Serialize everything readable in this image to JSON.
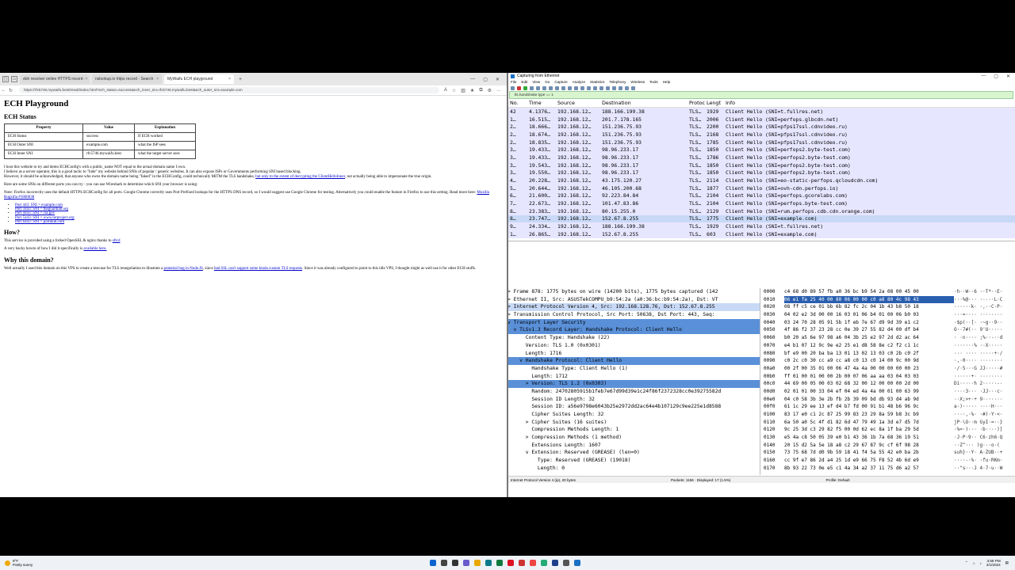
{
  "browser": {
    "tabs": [
      {
        "label": "doh resolver online HTTPS record ·"
      },
      {
        "label": "nslookup.io https record - Search"
      },
      {
        "label": "MyWaifu ECH playground"
      }
    ],
    "url": "https://rfc5746.mywaifu.best/result/index.html?ech_status=success&ech_inner_sni=rfc5746.mywaifu.best&ech_outer_sni=example.com",
    "page": {
      "title": "ECH Playground",
      "status_heading": "ECH Status",
      "table_headers": [
        "Property",
        "Value",
        "Explanation"
      ],
      "table_rows": [
        [
          "ECH Status",
          "success",
          "If ECH worked"
        ],
        [
          "ECH Outer SNI",
          "example.com",
          "what the ISP sees"
        ],
        [
          "ECH Inner SNI",
          "rfc5746.mywaifu.best",
          "what the target server sees"
        ]
      ],
      "para1": "I host this website to try and demo ECHConfig's with a public_name NOT equal to the actual domain name I own.",
      "para2": "I believe as a server operator, this is a good tactic to \"hide\" my website behind SNIs of popular / generic websites. It can also expose ISPs or Governments performing SNI based blocking.",
      "para3a": "However, it should be acknowledged, that anyone who owns the domain name being \"faked\" in the ECHConfig, could technically MiTM the TLS handshake,",
      "para3link": "but only to the extent of decrypting the ClientHelloInner",
      "para3b": ", not actually being able to impersonate the true origin.",
      "para4": "Here are some SNIs on different ports you can try - you can use Wireshark to determine which SNI your browser is using:",
      "para5a": "Note: Firefox incorrectly uses the default HTTPS ECHConfig for all ports. Google Chrome correctly uses Port Prefixed lookups for the HTTPS DNS record, so I would suggest use Google Chrome for testing. Alternatively you could enable the feature in Firefox to use this setting. Read more here:",
      "para5link": "Mozilla Bugzilla #1860038",
      "ports": [
        "Port 443: SNI = example.com",
        "Port 3443: SNI = theguardian.org",
        "Port 4443: SNI = cia.gov",
        "Port 5443: SNI = www.torproject.org",
        "Port 6443: SNI = pornhub.com"
      ],
      "how_heading": "How?",
      "how1a": "This service is provided using a forked OpenSSL & nginx thanks to",
      "how1link": "sftcd",
      "how2a": "A very hacky howto of how I did it specifically is",
      "how2link": "available here.",
      "why_heading": "Why this domain?",
      "why_a": "Well actually I used this domain on this VPS to create a testcase for TLS renegotiation to illustrate a",
      "why_link1": "potential bug in Node.JS",
      "why_b": ", since",
      "why_link2": "bad SSL can't support some kinda custom TLS requests",
      "why_c": ". Since it was already configured to point to this idle VPS, I thought might as well use it for other ECH stuffs."
    }
  },
  "wireshark": {
    "title": "Capturing from Ethernet",
    "menu": [
      "File",
      "Edit",
      "View",
      "Go",
      "Capture",
      "Analyze",
      "Statistics",
      "Telephony",
      "Wireless",
      "Tools",
      "Help"
    ],
    "filter": "tls.handshake.type == 1",
    "columns": [
      "No.",
      "Time",
      "Source",
      "Destination",
      "Protocol",
      "Length",
      "Info"
    ],
    "columns_display": [
      "No.",
      "Time",
      "Source",
      "Destination",
      "Protoc",
      "Lengt",
      "Info"
    ],
    "packets": [
      [
        "42",
        "4.1376…",
        "192.168.12…",
        "188.166.199.38",
        "TLS…",
        "1929",
        "Client Hello (SNI=t.fullres.net)"
      ],
      [
        "1…",
        "16.515…",
        "192.168.12…",
        "201.7.178.165",
        "TLS…",
        "2006",
        "Client Hello (SNI=perfops.glbcdn.net)"
      ],
      [
        "2…",
        "18.666…",
        "192.168.12…",
        "151.236.75.93",
        "TLS…",
        "2200",
        "Client Hello (SNI=pfps17ssl.cdnvideo.ru)"
      ],
      [
        "2…",
        "18.674…",
        "192.168.12…",
        "151.236.75.93",
        "TLS…",
        "2168",
        "Client Hello (SNI=pfps17ssl.cdnvideo.ru)"
      ],
      [
        "2…",
        "18.835…",
        "192.168.12…",
        "151.236.75.93",
        "TLS…",
        "1785",
        "Client Hello (SNI=pfps17ssl.cdnvideo.ru)"
      ],
      [
        "3…",
        "19.433…",
        "192.168.12…",
        "98.96.233.17",
        "TLS…",
        "1850",
        "Client Hello (SNI=perfops2.byte-test.com)"
      ],
      [
        "3…",
        "19.433…",
        "192.168.12…",
        "98.96.233.17",
        "TLS…",
        "1786",
        "Client Hello (SNI=perfops2.byte-test.com)"
      ],
      [
        "3…",
        "19.543…",
        "192.168.12…",
        "98.96.233.17",
        "TLS…",
        "1850",
        "Client Hello (SNI=perfops2.byte-test.com)"
      ],
      [
        "3…",
        "19.550…",
        "192.168.12…",
        "98.96.233.17",
        "TLS…",
        "1850",
        "Client Hello (SNI=perfops2.byte-test.com)"
      ],
      [
        "4…",
        "20.228…",
        "192.168.12…",
        "43.175.120.27",
        "TLS…",
        "2114",
        "Client Hello (SNI=eo-static-perfops.qcloudcdn.com)"
      ],
      [
        "5…",
        "20.644…",
        "192.168.12…",
        "46.105.200.68",
        "TLS…",
        "1877",
        "Client Hello (SNI=ovh-cdn.perfops.io)"
      ],
      [
        "6…",
        "21.600…",
        "192.168.12…",
        "92.223.84.84",
        "TLS…",
        "2104",
        "Client Hello (SNI=perfops.gcorelabs.com)"
      ],
      [
        "7…",
        "22.673…",
        "192.168.12…",
        "101.47.83.86",
        "TLS…",
        "2104",
        "Client Hello (SNI=perfops.byte-test.com)"
      ],
      [
        "8…",
        "23.383…",
        "192.168.12…",
        "80.15.255.0",
        "TLS…",
        "2129",
        "Client Hello (SNI=rum.perfops.cdb.cdn.orange.com)"
      ],
      [
        "8…",
        "23.747…",
        "192.168.12…",
        "152.67.8.255",
        "TLS…",
        "1775",
        "Client Hello (SNI=example.com)"
      ],
      [
        "9…",
        "24.334…",
        "192.168.12…",
        "188.166.199.38",
        "TLS…",
        "1929",
        "Client Hello (SNI=t.fullres.net)"
      ],
      [
        "1…",
        "26.865…",
        "192.168.12…",
        "152.67.8.255",
        "TLS…",
        "603",
        "Client Hello (SNI=example.com)"
      ]
    ],
    "details": [
      "> Frame 878: 1775 bytes on wire (14200 bits), 1775 bytes captured (142",
      "> Ethernet II, Src: ASUSTekCOMPU_b9:54:2a (a0:36:bc:b9:54:2a), Dst: VT",
      "> Internet Protocol Version 4, Src: 192.168.128.76, Dst: 152.67.8.255",
      "> Transmission Control Protocol, Src Port: 50638, Dst Port: 443, Seq:",
      "v Transport Layer Security",
      "  v TLSv1.3 Record Layer: Handshake Protocol: Client Hello",
      "      Content Type: Handshake (22)",
      "      Version: TLS 1.0 (0x0301)",
      "      Length: 1716",
      "    v Handshake Protocol: Client Hello",
      "        Handshake Type: Client Hello (1)",
      "        Length: 1712",
      "      > Version: TLS 1.2 (0x0303)",
      "        Random: 24702805915b1feb7e67d99d39e1c24f86f2372328cc0e39275582d",
      "        Session ID Length: 32",
      "        Session ID: a56e9798e6043b25e2972dd2ac64e4b107129c9ee225e1d8588",
      "        Cipher Suites Length: 32",
      "      > Cipher Suites (16 suites)",
      "        Compression Methods Length: 1",
      "      > Compression Methods (1 method)",
      "        Extensions Length: 1607",
      "      v Extension: Reserved (GREASE) (len=0)",
      "          Type: Reserved (GREASE) (19018)",
      "          Length: 0"
    ],
    "hex": [
      [
        "0000",
        "c4 68 d0 89 57 fb a0 36 bc b9 54 2a 08 00 45 00",
        "·h··W··6 ··T*··E·"
      ],
      [
        "0010",
        "06 e1 fa 25 40 00 80 06 00 00 c0 a8 80 4c 98 43",
        "···%@··· ·····L·C"
      ],
      [
        "0020",
        "08 ff c5 ce 01 bb 6b 82 fc 2c 04 1b 43 b8 50 18",
        "······k· ·,··C·P·"
      ],
      [
        "0030",
        "04 02 e2 3d 00 00 16 03 01 06 b4 01 00 06 b0 03",
        "···=···· ········"
      ],
      [
        "0040",
        "03 24 70 28 05 91 5b 1f eb 7e 67 d9 9d 39 e1 c2",
        "·$p(··[· ·~g··9··"
      ],
      [
        "0050",
        "4f 86 f2 37 23 28 cc 0e 39 27 55 82 d4 00 df b4",
        "O··7#(·· 9'U·····"
      ],
      [
        "0060",
        "b0 20 a5 6e 97 98 a6 04 3b 25 e2 97 2d d2 ac 64",
        "· ·n···· ;%··-··d"
      ],
      [
        "0070",
        "e4 b1 07 12 9c 9e e2 25 e1 d8 58 8e c2 f2 c1 1c",
        "·······% ··X·····"
      ],
      [
        "0080",
        "bf e9 00 20 ba ba 13 01 13 02 13 03 c0 2b c0 2f",
        "··· ···· ·····+·/"
      ],
      [
        "0090",
        "c0 2c c0 30 cc a9 cc a8 c0 13 c0 14 00 9c 00 9d",
        "·,·0···· ········"
      ],
      [
        "00a0",
        "00 2f 00 35 01 00 06 47 4a 4a 00 00 00 00 00 23",
        "·/·5···G JJ·····#"
      ],
      [
        "00b0",
        "ff 01 00 01 00 00 2b 00 07 06 aa aa 03 04 03 03",
        "······+· ········"
      ],
      [
        "00c0",
        "44 69 00 05 00 03 02 68 32 00 12 00 00 00 2d 00",
        "Di·····h 2·····-·"
      ],
      [
        "00d0",
        "02 01 01 00 33 04 ef 04 ed 4a 4a 00 01 00 63 99",
        "····3··· ·JJ···c·"
      ],
      [
        "00e0",
        "04 c0 58 3b 3e 2b fb 2b 39 09 bd db 93 d4 ab 9d",
        "··X;>+·+ 9·······"
      ],
      [
        "00f0",
        "61 1c 29 ee 13 ef d4 b7 fd 00 91 b1 48 b6 96 9c",
        "a·)····· ····H···"
      ],
      [
        "0100",
        "83 17 e0 c1 2c 87 25 99 83 23 29 8a 59 b8 3c b9",
        "····,·%· ·#)·Y·<·"
      ],
      [
        "0110",
        "6a 50 a0 5c 4f d1 82 6d 47 79 49 1a 3d e7 d5 7d",
        "jP·\\O··m GyI·=··}"
      ],
      [
        "0120",
        "9c 25 3d c3 29 82 f5 00 0d 62 ec 8a 1f ba 29 5d",
        "·%=·)··· ·b····)]"
      ],
      [
        "0130",
        "e5 4a c8 50 05 39 e0 b1 43 36 1b 7a 68 36 19 51",
        "·J·P·9·· C6·zh6·Q"
      ],
      [
        "0140",
        "20 15 d2 5a 5e 18 a8 c2 29 67 87 9c cf 6f 98 28",
        " ··Z^··· )g···o·("
      ],
      [
        "0150",
        "73 75 68 7d d0 9b 59 18 41 f4 5a 55 42 e0 ba 2b",
        "suh}··Y· A·ZUB··+"
      ],
      [
        "0160",
        "cc 9f e7 86 2d a4 25 1d e9 66 75 F8 52 4b 6d e9",
        "····-·%· ·fu·RKm·"
      ],
      [
        "0170",
        "8b 93 22 73 0e e5 c1 4a 34 a2 37 11 75 d6 a2 57",
        "··\"s···J 4·7·u··W"
      ]
    ],
    "status_left": "Internet Protocol Version 4 (ip), 20 bytes",
    "status_mid": "Packets: 1156 · Displayed: 17 (1.5%)",
    "status_right": "Profile: Default"
  },
  "taskbar": {
    "temp": "9°F",
    "weather": "Partly sunny",
    "time": "3:59 PM",
    "date": "4/1/2024"
  }
}
